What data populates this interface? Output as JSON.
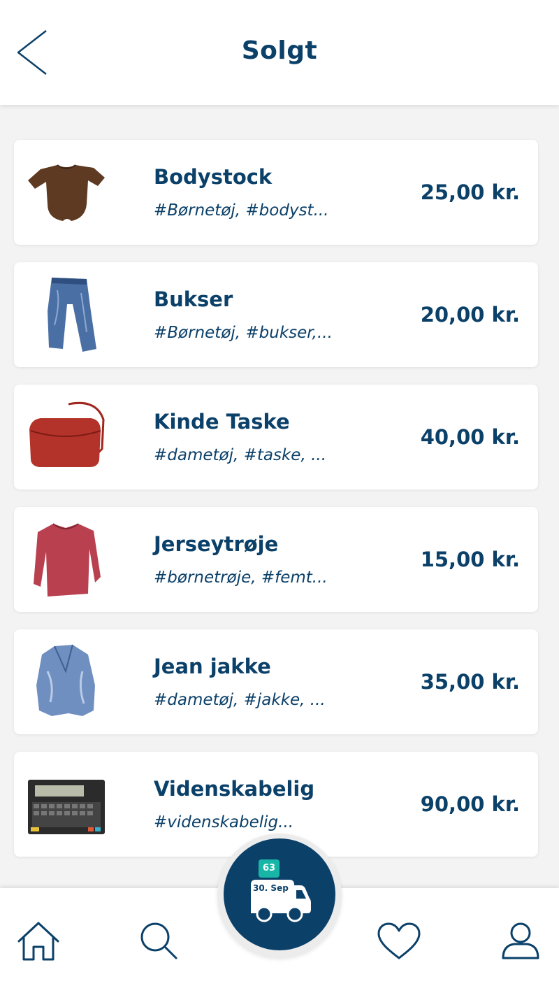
{
  "header": {
    "title": "Solgt",
    "back_icon": "chevron-left-icon"
  },
  "items": [
    {
      "title": "Bodystock",
      "tags": "#Børnetøj, #bodyst...",
      "price": "25,00 kr.",
      "image": "brown-bodysuit"
    },
    {
      "title": "Bukser",
      "tags": "#Børnetøj, #bukser,...",
      "price": "20,00 kr.",
      "image": "blue-jeans"
    },
    {
      "title": "Kinde Taske",
      "tags": "#dametøj, #taske, ...",
      "price": "40,00 kr.",
      "image": "red-handbag"
    },
    {
      "title": "Jerseytrøje",
      "tags": "#børnetrøje, #femt...",
      "price": "15,00 kr.",
      "image": "red-sweater"
    },
    {
      "title": "Jean jakke",
      "tags": "#dametøj, #jakke, ...",
      "price": "35,00 kr.",
      "image": "denim-jacket"
    },
    {
      "title": "Videnskabelig",
      "tags": "#videnskabelig...",
      "price": "90,00 kr.",
      "image": "calculator-device"
    }
  ],
  "fab": {
    "badge": "63",
    "date": "30. Sep",
    "icon": "delivery-truck-icon"
  },
  "bottom_nav": [
    {
      "name": "home",
      "icon": "home-icon"
    },
    {
      "name": "search",
      "icon": "search-icon"
    },
    {
      "name": "favorites",
      "icon": "heart-icon"
    },
    {
      "name": "profile",
      "icon": "user-icon"
    }
  ],
  "colors": {
    "primary": "#0b4069",
    "accent": "#18b6a6",
    "background": "#f3f3f3"
  }
}
